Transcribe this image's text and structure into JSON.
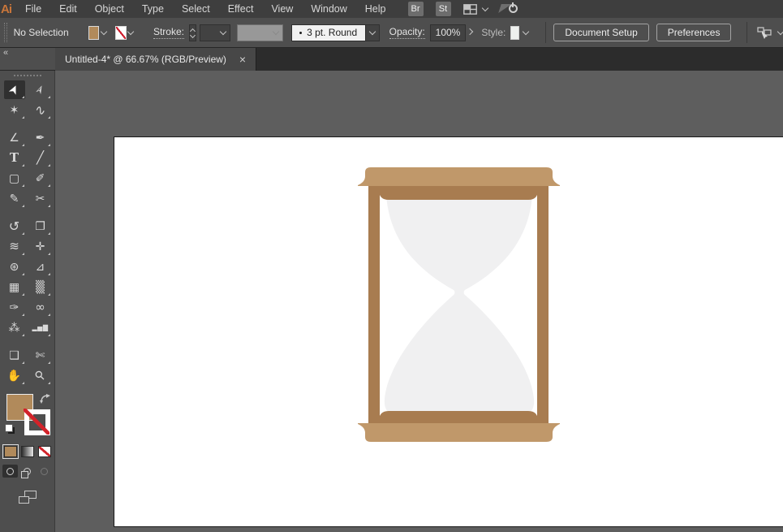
{
  "menu_bar": {
    "logo": "Ai",
    "items": [
      "File",
      "Edit",
      "Object",
      "Type",
      "Select",
      "Effect",
      "View",
      "Window",
      "Help"
    ],
    "bridge_label": "Br",
    "stock_label": "St"
  },
  "control_bar": {
    "selection_status": "No Selection",
    "stroke_label": "Stroke:",
    "brush_value": "3 pt. Round",
    "opacity_label": "Opacity:",
    "opacity_value": "100%",
    "style_label": "Style:",
    "document_setup_label": "Document Setup",
    "preferences_label": "Preferences"
  },
  "tab_bar": {
    "collapse_glyph": "«",
    "document_title": "Untitled-4* @ 66.67% (RGB/Preview)",
    "close_glyph": "×"
  },
  "toolbar": {
    "tools": [
      {
        "name": "selection-tool",
        "glyph": "➤",
        "selected": true
      },
      {
        "name": "direct-selection-tool",
        "glyph": "➢"
      },
      {
        "name": "magic-wand-tool",
        "glyph": "✶"
      },
      {
        "name": "lasso-tool",
        "glyph": "∿",
        "gap": true
      },
      {
        "name": "curvature-tool",
        "glyph": "∠"
      },
      {
        "name": "pen-tool",
        "glyph": "✒"
      },
      {
        "name": "type-tool",
        "glyph": "T"
      },
      {
        "name": "line-segment-tool",
        "glyph": "╱"
      },
      {
        "name": "rectangle-tool",
        "glyph": "▢"
      },
      {
        "name": "paintbrush-tool",
        "glyph": "✐"
      },
      {
        "name": "shaper-tool",
        "glyph": "✎"
      },
      {
        "name": "scissors-tool",
        "glyph": "✂",
        "gap": true
      },
      {
        "name": "rotate-tool",
        "glyph": "↺"
      },
      {
        "name": "scale-tool",
        "glyph": "❐"
      },
      {
        "name": "width-tool",
        "glyph": "≋"
      },
      {
        "name": "puppet-warp-tool",
        "glyph": "✛"
      },
      {
        "name": "shape-builder-tool",
        "glyph": "⊛"
      },
      {
        "name": "perspective-grid-tool",
        "glyph": "⊿"
      },
      {
        "name": "mesh-tool",
        "glyph": "▦"
      },
      {
        "name": "gradient-tool",
        "glyph": "▒"
      },
      {
        "name": "eyedropper-tool",
        "glyph": "✑"
      },
      {
        "name": "blend-tool",
        "glyph": "∞"
      },
      {
        "name": "symbol-sprayer-tool",
        "glyph": "⁂"
      },
      {
        "name": "column-graph-tool",
        "glyph": "▂▅▇",
        "gap": true
      },
      {
        "name": "artboard-tool",
        "glyph": "❑"
      },
      {
        "name": "slice-tool",
        "glyph": "✄"
      },
      {
        "name": "hand-tool",
        "glyph": "✋"
      },
      {
        "name": "zoom-tool",
        "glyph": "⚲"
      }
    ]
  },
  "colors": {
    "logo_orange": "#c9763a",
    "fill_swatch": "#b18a5b",
    "stroke_none_red": "#d2232a",
    "hourglass_cap": "#c0986a",
    "hourglass_frame": "#a87c50",
    "hourglass_glass": "#f0f0f1",
    "artboard_white": "#ffffff",
    "pasteboard_gray": "#5e5e5e"
  }
}
